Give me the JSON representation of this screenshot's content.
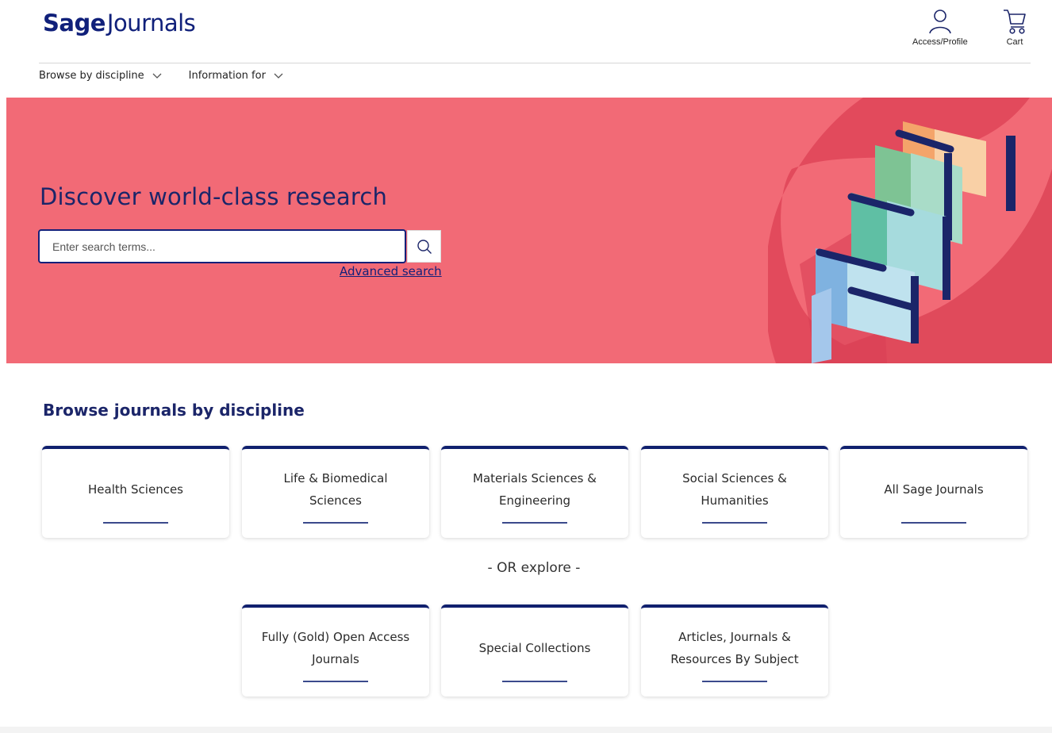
{
  "header": {
    "logo_bold": "Sage",
    "logo_thin": "Journals",
    "profile_label": "Access/Profile",
    "cart_label": "Cart"
  },
  "nav": {
    "items": [
      {
        "label": "Browse by discipline",
        "icon": "chevron-down-icon"
      },
      {
        "label": "Information for",
        "icon": "chevron-down-icon"
      }
    ]
  },
  "hero": {
    "title": "Discover world-class research",
    "search_placeholder": "Enter search terms...",
    "search_value": "",
    "advanced_search": "Advanced search",
    "background_color": "#f26a76"
  },
  "browse": {
    "title": "Browse journals by discipline",
    "cards": [
      {
        "label": "Health Sciences"
      },
      {
        "label": "Life & Biomedical Sciences"
      },
      {
        "label": "Materials Sciences & Engineering"
      },
      {
        "label": "Social Sciences & Humanities"
      },
      {
        "label": "All Sage Journals"
      }
    ],
    "or_explore": "- OR explore -",
    "explore_cards": [
      {
        "label": "Fully (Gold) Open Access Journals"
      },
      {
        "label": "Special Collections"
      },
      {
        "label": "Articles, Journals & Resources By Subject"
      }
    ]
  },
  "colors": {
    "brand_navy": "#10207a",
    "hero_coral": "#f26a76"
  }
}
